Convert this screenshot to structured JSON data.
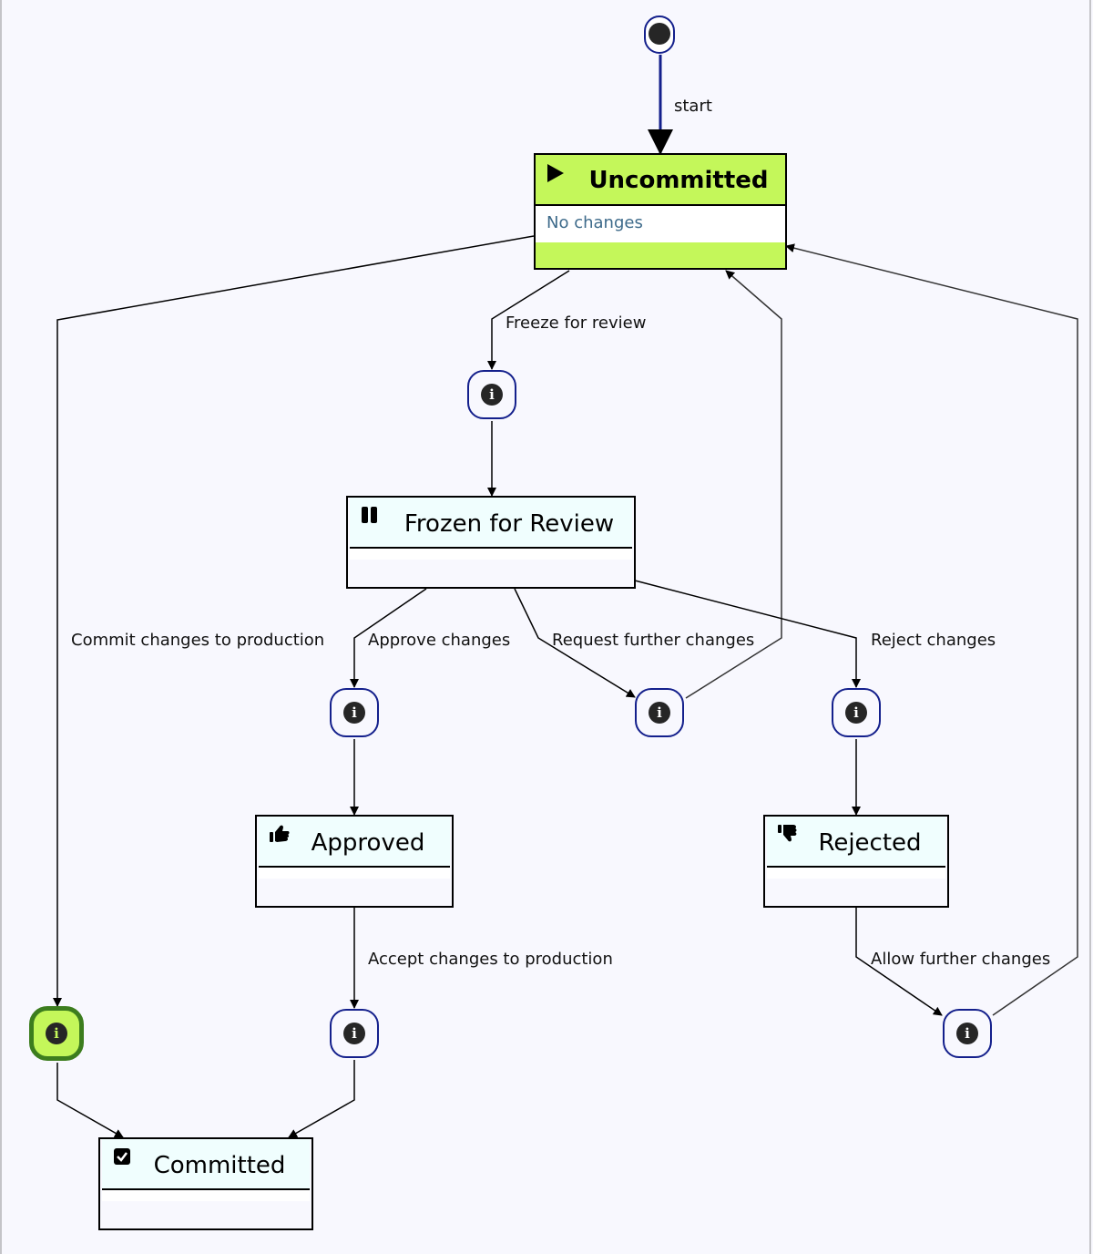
{
  "diagram": {
    "type": "state-machine",
    "initial": {
      "label": "start",
      "target": "Uncommitted"
    },
    "states": {
      "uncommitted": {
        "name": "Uncommitted",
        "description": "No changes",
        "icon": "play-icon",
        "active": true
      },
      "frozen": {
        "name": "Frozen for Review",
        "icon": "pause-icon",
        "active": false
      },
      "approved": {
        "name": "Approved",
        "icon": "thumbs-up-icon",
        "active": false
      },
      "rejected": {
        "name": "Rejected",
        "icon": "thumbs-down-icon",
        "active": false
      },
      "committed": {
        "name": "Committed",
        "icon": "checkbox-checked-icon",
        "active": false
      }
    },
    "transitions": {
      "freeze": {
        "label": "Freeze for review",
        "from": "Uncommitted",
        "to": "Frozen for Review"
      },
      "commit": {
        "label": "Commit changes to production",
        "from": "Uncommitted",
        "to": "Committed",
        "active": true
      },
      "approve": {
        "label": "Approve changes",
        "from": "Frozen for Review",
        "to": "Approved"
      },
      "request": {
        "label": "Request further changes",
        "from": "Frozen for Review",
        "to": "Uncommitted"
      },
      "reject": {
        "label": "Reject changes",
        "from": "Frozen for Review",
        "to": "Rejected"
      },
      "accept": {
        "label": "Accept changes to production",
        "from": "Approved",
        "to": "Committed"
      },
      "allow": {
        "label": "Allow further changes",
        "from": "Rejected",
        "to": "Uncommitted"
      }
    },
    "info_glyph": "i",
    "colors": {
      "active_fill": "#c4f75a",
      "active_border": "#3c7d1e",
      "choice_border": "#14208c",
      "state_header": "#f0fefe",
      "background": "#f8f8fe",
      "description_text": "#3d6a8a"
    }
  }
}
